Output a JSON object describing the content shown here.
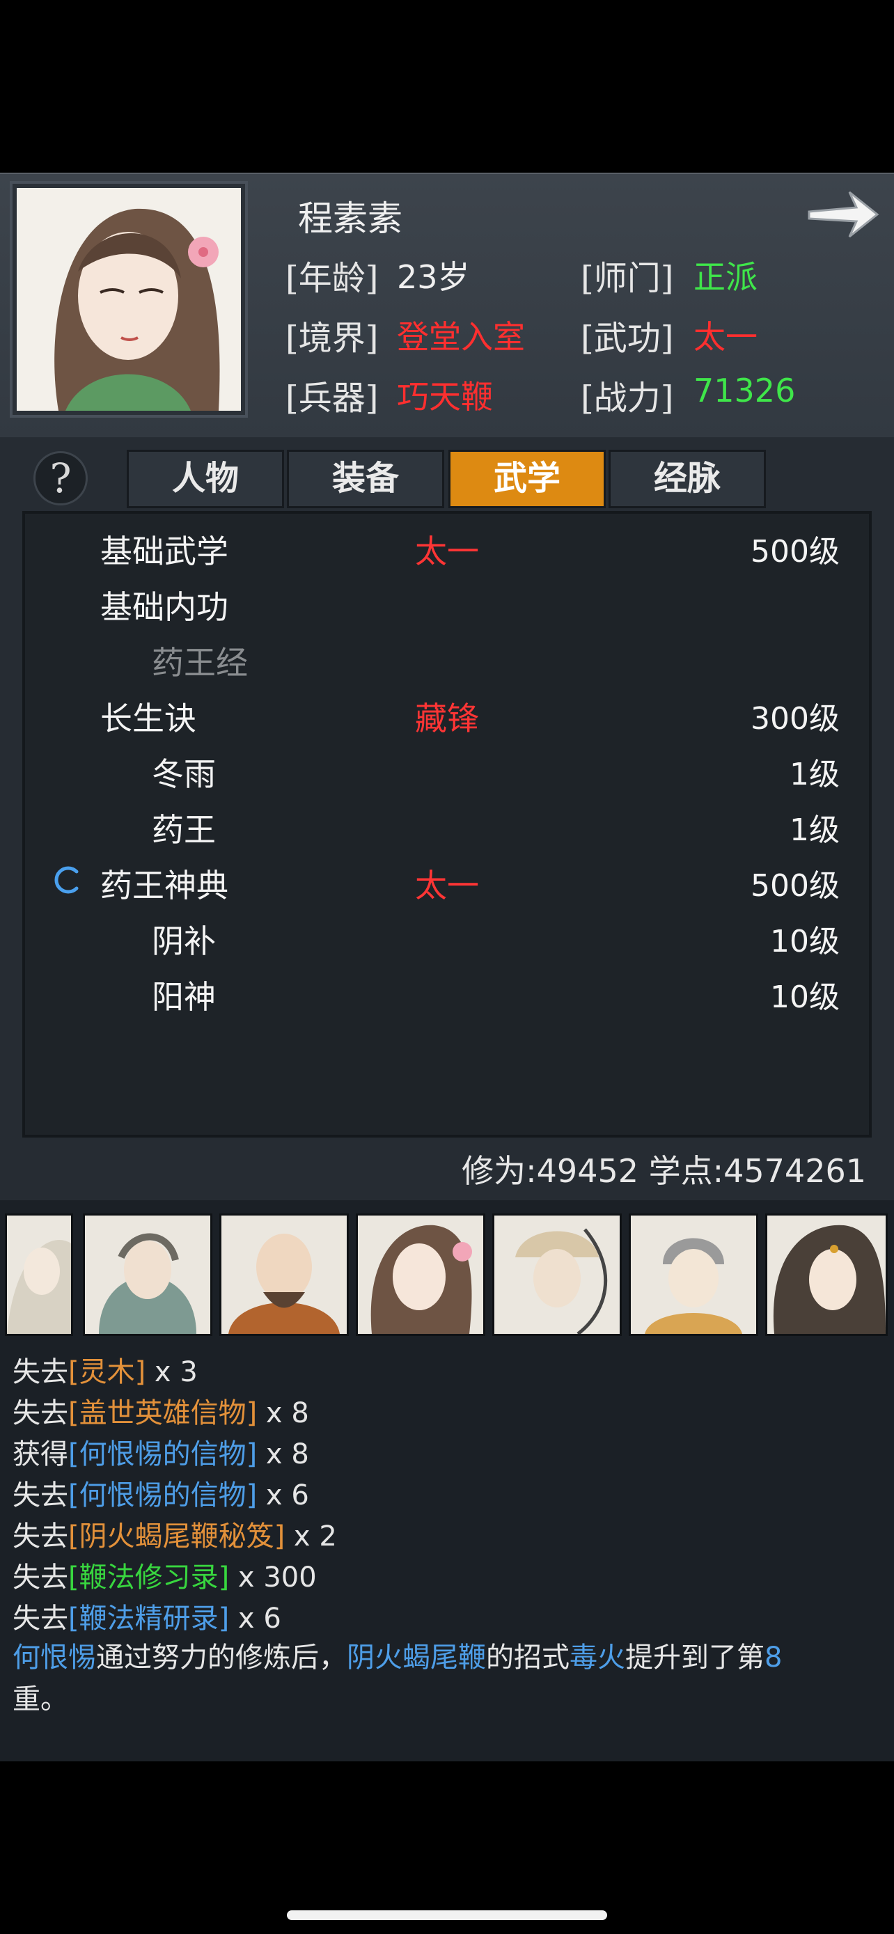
{
  "character": {
    "name": "程素素",
    "age_label": "[年龄]",
    "age": "23岁",
    "sect_label": "[师门]",
    "sect": "正派",
    "realm_label": "[境界]",
    "realm": "登堂入室",
    "martial_label": "[武功]",
    "martial": "太一",
    "weapon_label": "[兵器]",
    "weapon": "巧天鞭",
    "power_label": "[战力]",
    "power": "71326"
  },
  "help_icon": "?",
  "tabs": [
    {
      "label": "人物",
      "active": false
    },
    {
      "label": "装备",
      "active": false
    },
    {
      "label": "武学",
      "active": true
    },
    {
      "label": "经脉",
      "active": false
    }
  ],
  "skills": [
    {
      "name": "基础武学",
      "tag": "太一",
      "level": "500级",
      "indent": false,
      "dim": false
    },
    {
      "name": "基础内功",
      "tag": "",
      "level": "",
      "indent": false,
      "dim": false
    },
    {
      "name": "药王经",
      "tag": "",
      "level": "",
      "indent": true,
      "dim": true
    },
    {
      "name": "长生诀",
      "tag": "藏锋",
      "level": "300级",
      "indent": false,
      "dim": false
    },
    {
      "name": "冬雨",
      "tag": "",
      "level": "1级",
      "indent": true,
      "dim": false
    },
    {
      "name": "药王",
      "tag": "",
      "level": "1级",
      "indent": true,
      "dim": false
    },
    {
      "name": "药王神典",
      "tag": "太一",
      "level": "500级",
      "indent": false,
      "dim": false
    },
    {
      "name": "阴补",
      "tag": "",
      "level": "10级",
      "indent": true,
      "dim": false
    },
    {
      "name": "阳神",
      "tag": "",
      "level": "10级",
      "indent": true,
      "dim": false
    }
  ],
  "stats_line": "修为:49452  学点:4574261",
  "log": {
    "lines": [
      {
        "pre": "失去",
        "item": "[灵木]",
        "post": " x 3",
        "color": "o"
      },
      {
        "pre": "失去",
        "item": "[盖世英雄信物]",
        "post": " x 8",
        "color": "o"
      },
      {
        "pre": "获得",
        "item": "[何恨惕的信物]",
        "post": " x 8",
        "color": "b"
      },
      {
        "pre": "失去",
        "item": "[何恨惕的信物]",
        "post": " x 6",
        "color": "b"
      },
      {
        "pre": "失去",
        "item": "[阴火蝎尾鞭秘笈]",
        "post": " x 2",
        "color": "o"
      },
      {
        "pre": "失去",
        "item": "[鞭法修习录]",
        "post": " x 300",
        "color": "g"
      },
      {
        "pre": "失去",
        "item": "[鞭法精研录]",
        "post": " x 6",
        "color": "b"
      }
    ],
    "message": {
      "who": "何恨惕",
      "t1": "通过努力的修炼后，",
      "skill": "阴火蝎尾鞭",
      "t2": "的招式",
      "move": "毒火",
      "t3": "提升到了第",
      "num": "8",
      "t4": "重。"
    }
  }
}
